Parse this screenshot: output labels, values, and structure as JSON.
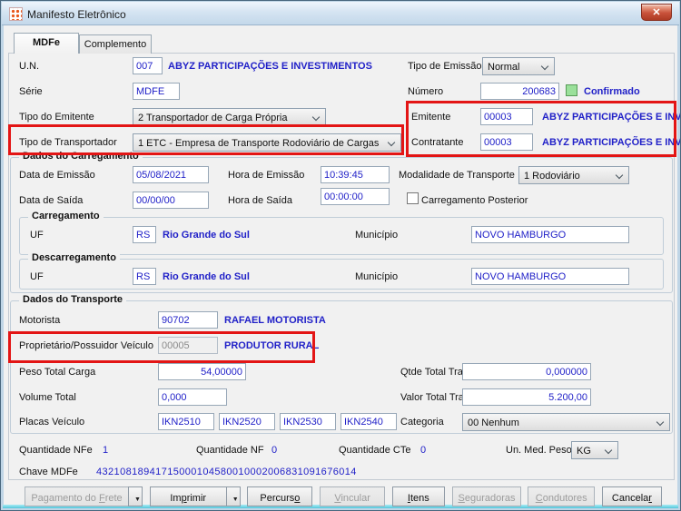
{
  "window": {
    "title": "Manifesto Eletrônico",
    "close_glyph": "✕"
  },
  "tabs": {
    "mdfe": "MDFe",
    "complemento": "Complemento"
  },
  "colors": {
    "annotation_red": "#e31515",
    "value_blue": "#2121c8",
    "confirmed_green": "#9ae09a"
  },
  "header_fields": {
    "un": {
      "label": "U.N.",
      "value": "007",
      "desc": "ABYZ PARTICIPAÇÕES E INVESTIMENTOS"
    },
    "tipo_emissao": {
      "label": "Tipo de Emissão",
      "value": "Normal"
    },
    "serie": {
      "label": "Série",
      "value": "MDFE"
    },
    "numero": {
      "label": "Número",
      "value": "200683",
      "confirm_label": "Confirmado"
    },
    "tipo_emitente": {
      "label": "Tipo do Emitente",
      "value": "2 Transportador de Carga Própria"
    },
    "emitente": {
      "label": "Emitente",
      "value": "00003",
      "desc": "ABYZ PARTICIPAÇÕES E INVEST"
    },
    "tipo_transportador": {
      "label": "Tipo de Transportador",
      "value": "1 ETC - Empresa de Transporte Rodoviário de Cargas"
    },
    "contratante": {
      "label": "Contratante",
      "value": "00003",
      "desc": "ABYZ PARTICIPAÇÕES E INVEST"
    }
  },
  "carregamento": {
    "title": "Dados do Carregamento",
    "data_emissao": {
      "label": "Data de Emissão",
      "value": "05/08/2021"
    },
    "hora_emissao": {
      "label": "Hora de Emissão",
      "value": "10:39:45"
    },
    "modalidade": {
      "label": "Modalidade de Transporte",
      "value": "1 Rodoviário"
    },
    "data_saida": {
      "label": "Data de Saída",
      "value": "00/00/00"
    },
    "hora_saida": {
      "label": "Hora de Saída",
      "value": "00:00:00"
    },
    "carregamento_posterior": {
      "label": "Carregamento Posterior",
      "checked": false
    },
    "origem": {
      "title": "Carregamento",
      "uf_label": "UF",
      "uf": "RS",
      "uf_desc": "Rio Grande do Sul",
      "municipio_label": "Município",
      "municipio": "NOVO HAMBURGO"
    },
    "destino": {
      "title": "Descarregamento",
      "uf_label": "UF",
      "uf": "RS",
      "uf_desc": "Rio Grande do Sul",
      "municipio_label": "Município",
      "municipio": "NOVO HAMBURGO"
    }
  },
  "transporte": {
    "title": "Dados do Transporte",
    "motorista": {
      "label": "Motorista",
      "value": "90702",
      "desc": "RAFAEL MOTORISTA"
    },
    "proprietario": {
      "label": "Proprietário/Possuidor Veículo",
      "value": "00005",
      "desc": "PRODUTOR RURAL"
    },
    "peso": {
      "label": "Peso Total Carga",
      "value": "54,00000"
    },
    "qtde": {
      "label": "Qtde Total Transp.",
      "value": "0,000000"
    },
    "volume": {
      "label": "Volume Total",
      "value": "0,000"
    },
    "valor": {
      "label": "Valor Total Transp.",
      "value": "5.200,00"
    },
    "placas": {
      "label": "Placas Veículo",
      "values": [
        "IKN2510",
        "IKN2520",
        "IKN2530",
        "IKN2540"
      ]
    },
    "categoria": {
      "label": "Categoria",
      "value": "00 Nenhum"
    }
  },
  "totais": {
    "qtd_nfe": {
      "label": "Quantidade NFe",
      "value": "1"
    },
    "qtd_nf": {
      "label": "Quantidade NF",
      "value": "0"
    },
    "qtd_cte": {
      "label": "Quantidade CTe",
      "value": "0"
    },
    "un_med_peso": {
      "label": "Un. Med. Peso",
      "value": "KG"
    },
    "chave": {
      "label": "Chave MDFe",
      "value": "43210818941715000104580010002006831091676014"
    }
  },
  "buttons": {
    "dropdown_glyph": "▼",
    "pagamento_frete": {
      "pre": "Pagamento do ",
      "u": "F",
      "post": "rete",
      "disabled": true
    },
    "imprimir": {
      "pre": "Im",
      "u": "p",
      "post": "rimir",
      "disabled": false
    },
    "percurso": {
      "pre": "Percurs",
      "u": "o",
      "post": "",
      "disabled": false
    },
    "vincular": {
      "pre": "",
      "u": "V",
      "post": "incular",
      "disabled": true
    },
    "itens": {
      "pre": "",
      "u": "I",
      "post": "tens",
      "disabled": false
    },
    "seguradoras": {
      "pre": "",
      "u": "S",
      "post": "eguradoras",
      "disabled": true
    },
    "condutores": {
      "pre": "",
      "u": "C",
      "post": "ondutores",
      "disabled": true
    },
    "cancelar": {
      "pre": "Cancela",
      "u": "r",
      "post": "",
      "disabled": false
    }
  }
}
